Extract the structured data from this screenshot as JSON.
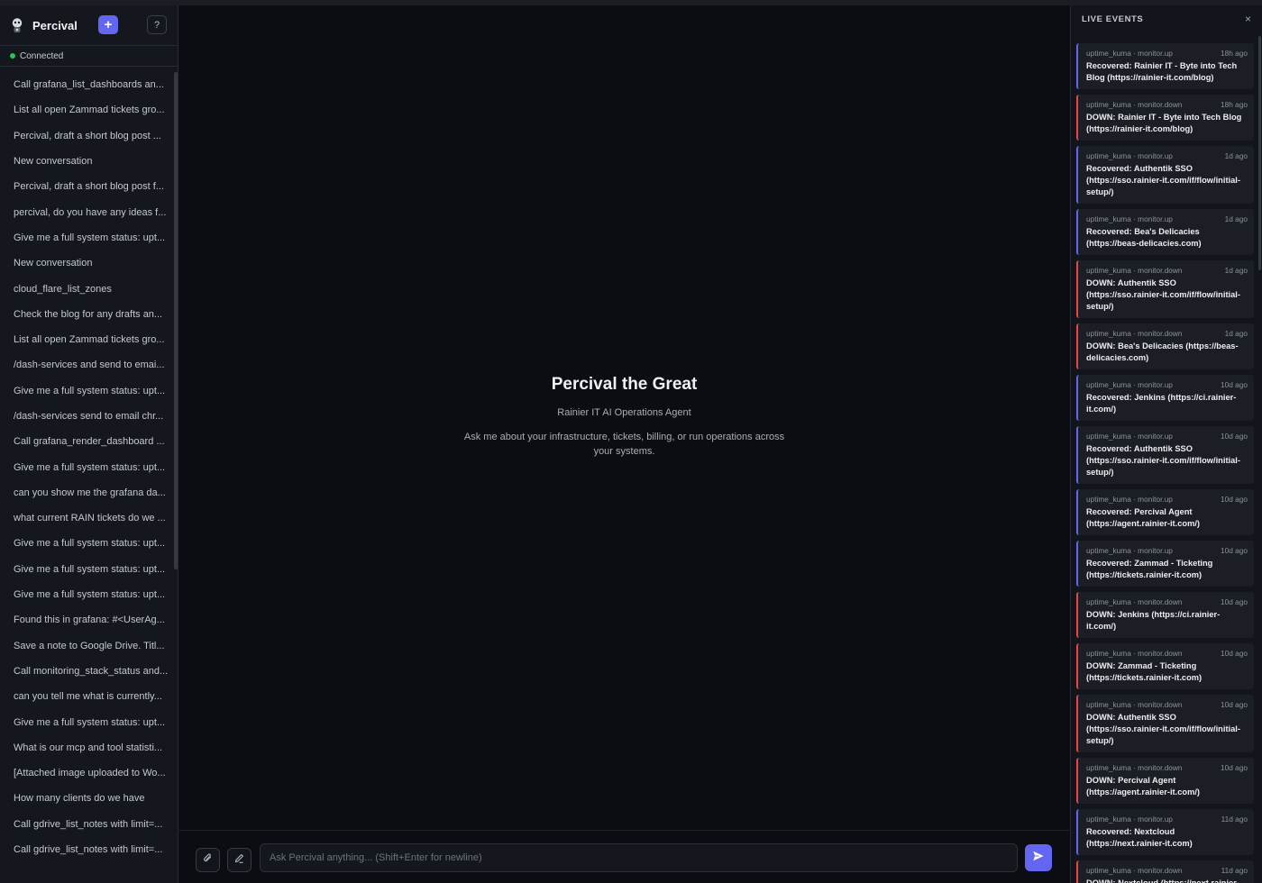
{
  "app": {
    "name": "Percival",
    "new_label": "+",
    "help_label": "?",
    "status": "Connected",
    "accent": "#6366f1",
    "status_color": "#22c55e"
  },
  "conversations": [
    "Call grafana_list_dashboards an...",
    "List all open Zammad tickets gro...",
    "Percival, draft a short blog post ...",
    "New conversation",
    "Percival, draft a short blog post f...",
    "percival, do you have any ideas f...",
    "Give me a full system status: upt...",
    "New conversation",
    "cloud_flare_list_zones",
    "Check the blog for any drafts an...",
    "List all open Zammad tickets gro...",
    "/dash-services and send to emai...",
    "Give me a full system status: upt...",
    "/dash-services send to email chr...",
    "Call grafana_render_dashboard ...",
    "Give me a full system status: upt...",
    "can you show me the grafana da...",
    "what current RAIN tickets do we ...",
    "Give me a full system status: upt...",
    "Give me a full system status: upt...",
    "Give me a full system status: upt...",
    "Found this in grafana: #<UserAg...",
    "Save a note to Google Drive. Titl...",
    "Call monitoring_stack_status and...",
    "can you tell me what is currently...",
    "Give me a full system status: upt...",
    "What is our mcp and tool statisti...",
    "[Attached image uploaded to Wo...",
    "How many clients do we have",
    "Call gdrive_list_notes with limit=...",
    "Call gdrive_list_notes with limit=..."
  ],
  "hero": {
    "title": "Percival the Great",
    "subtitle": "Rainier IT AI Operations Agent",
    "description": "Ask me about your infrastructure, tickets, billing, or run operations across your systems."
  },
  "composer": {
    "placeholder": "Ask Percival anything... (Shift+Enter for newline)",
    "attach_icon": "paperclip-icon",
    "pen_icon": "pen-icon",
    "send_icon": "send-icon"
  },
  "events_panel": {
    "title": "LIVE EVENTS",
    "close_label": "×",
    "items": [
      {
        "source": "uptime_kuma · monitor.up",
        "kind": "up",
        "time": "18h ago",
        "message": "Recovered: Rainier IT - Byte into Tech Blog (https://rainier-it.com/blog)"
      },
      {
        "source": "uptime_kuma · monitor.down",
        "kind": "down",
        "time": "18h ago",
        "message": "DOWN: Rainier IT - Byte into Tech Blog (https://rainier-it.com/blog)"
      },
      {
        "source": "uptime_kuma · monitor.up",
        "kind": "up",
        "time": "1d ago",
        "message": "Recovered: Authentik SSO (https://sso.rainier-it.com/if/flow/initial-setup/)"
      },
      {
        "source": "uptime_kuma · monitor.up",
        "kind": "up",
        "time": "1d ago",
        "message": "Recovered: Bea's Delicacies (https://beas-delicacies.com)"
      },
      {
        "source": "uptime_kuma · monitor.down",
        "kind": "down",
        "time": "1d ago",
        "message": "DOWN: Authentik SSO (https://sso.rainier-it.com/if/flow/initial-setup/)"
      },
      {
        "source": "uptime_kuma · monitor.down",
        "kind": "down",
        "time": "1d ago",
        "message": "DOWN: Bea's Delicacies (https://beas-delicacies.com)"
      },
      {
        "source": "uptime_kuma · monitor.up",
        "kind": "up",
        "time": "10d ago",
        "message": "Recovered: Jenkins (https://ci.rainier-it.com/)"
      },
      {
        "source": "uptime_kuma · monitor.up",
        "kind": "up",
        "time": "10d ago",
        "message": "Recovered: Authentik SSO (https://sso.rainier-it.com/if/flow/initial-setup/)"
      },
      {
        "source": "uptime_kuma · monitor.up",
        "kind": "up",
        "time": "10d ago",
        "message": "Recovered: Percival Agent (https://agent.rainier-it.com/)"
      },
      {
        "source": "uptime_kuma · monitor.up",
        "kind": "up",
        "time": "10d ago",
        "message": "Recovered: Zammad - Ticketing (https://tickets.rainier-it.com)"
      },
      {
        "source": "uptime_kuma · monitor.down",
        "kind": "down",
        "time": "10d ago",
        "message": "DOWN: Jenkins (https://ci.rainier-it.com/)"
      },
      {
        "source": "uptime_kuma · monitor.down",
        "kind": "down",
        "time": "10d ago",
        "message": "DOWN: Zammad - Ticketing (https://tickets.rainier-it.com)"
      },
      {
        "source": "uptime_kuma · monitor.down",
        "kind": "down",
        "time": "10d ago",
        "message": "DOWN: Authentik SSO (https://sso.rainier-it.com/if/flow/initial-setup/)"
      },
      {
        "source": "uptime_kuma · monitor.down",
        "kind": "down",
        "time": "10d ago",
        "message": "DOWN: Percival Agent (https://agent.rainier-it.com/)"
      },
      {
        "source": "uptime_kuma · monitor.up",
        "kind": "up",
        "time": "11d ago",
        "message": "Recovered: Nextcloud (https://next.rainier-it.com)"
      },
      {
        "source": "uptime_kuma · monitor.down",
        "kind": "down",
        "time": "11d ago",
        "message": "DOWN: Nextcloud (https://next.rainier-it.com)"
      }
    ]
  }
}
